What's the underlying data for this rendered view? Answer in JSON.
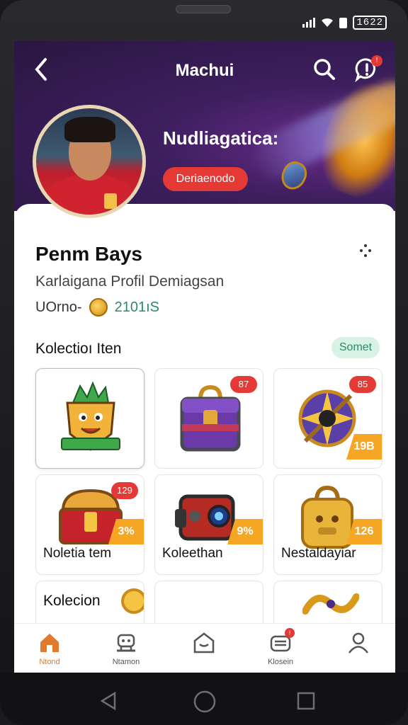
{
  "status": {
    "time": "1622"
  },
  "header": {
    "title": "Machui",
    "back_icon": "chevron-left-icon",
    "search_badge": "",
    "notif_badge": "!"
  },
  "hero": {
    "headline": "Nudliagatica:",
    "tag": "Deriaenodo"
  },
  "profile": {
    "name": "Penm Bays",
    "subtitle": "Karlaigana Profil Demiagsan",
    "stat_label": "UOrno-",
    "coins": "2101ıS"
  },
  "collection": {
    "title": "Kolectioı Iten",
    "filter_label": "Somet",
    "items": [
      {
        "badge": "",
        "corner": "",
        "label": "",
        "art": "mascot"
      },
      {
        "badge": "87",
        "corner": "",
        "label": "",
        "art": "chest-purple"
      },
      {
        "badge": "85",
        "corner": "19B",
        "label": "",
        "art": "shield"
      },
      {
        "badge": "129",
        "corner": "3%",
        "label": "Noletia tem",
        "art": "chest-red"
      },
      {
        "badge": "",
        "corner": "9%",
        "label": "Koleethan",
        "art": "machine"
      },
      {
        "badge": "",
        "corner": "126",
        "label": "Nestaldayiar",
        "art": "bag-gold"
      },
      {
        "badge": "",
        "corner": "",
        "label": "Kolecion",
        "art": "coin"
      },
      {
        "badge": "",
        "corner": "",
        "label": "",
        "art": "blank"
      },
      {
        "badge": "",
        "corner": "",
        "label": "",
        "art": "snake"
      }
    ]
  },
  "navbar": {
    "items": [
      {
        "label": "Ntond",
        "icon": "home-icon"
      },
      {
        "label": "Ntamon",
        "icon": "robot-icon"
      },
      {
        "label": "",
        "icon": "store-icon"
      },
      {
        "label": "Klosein",
        "icon": "inbox-icon",
        "badge": "!"
      },
      {
        "label": "",
        "icon": "profile-icon"
      }
    ]
  },
  "colors": {
    "accent": "#e53935",
    "hero_bg": "#3d1f5e",
    "active_nav": "#e07a2c",
    "coin_text": "#2b8a6e"
  }
}
